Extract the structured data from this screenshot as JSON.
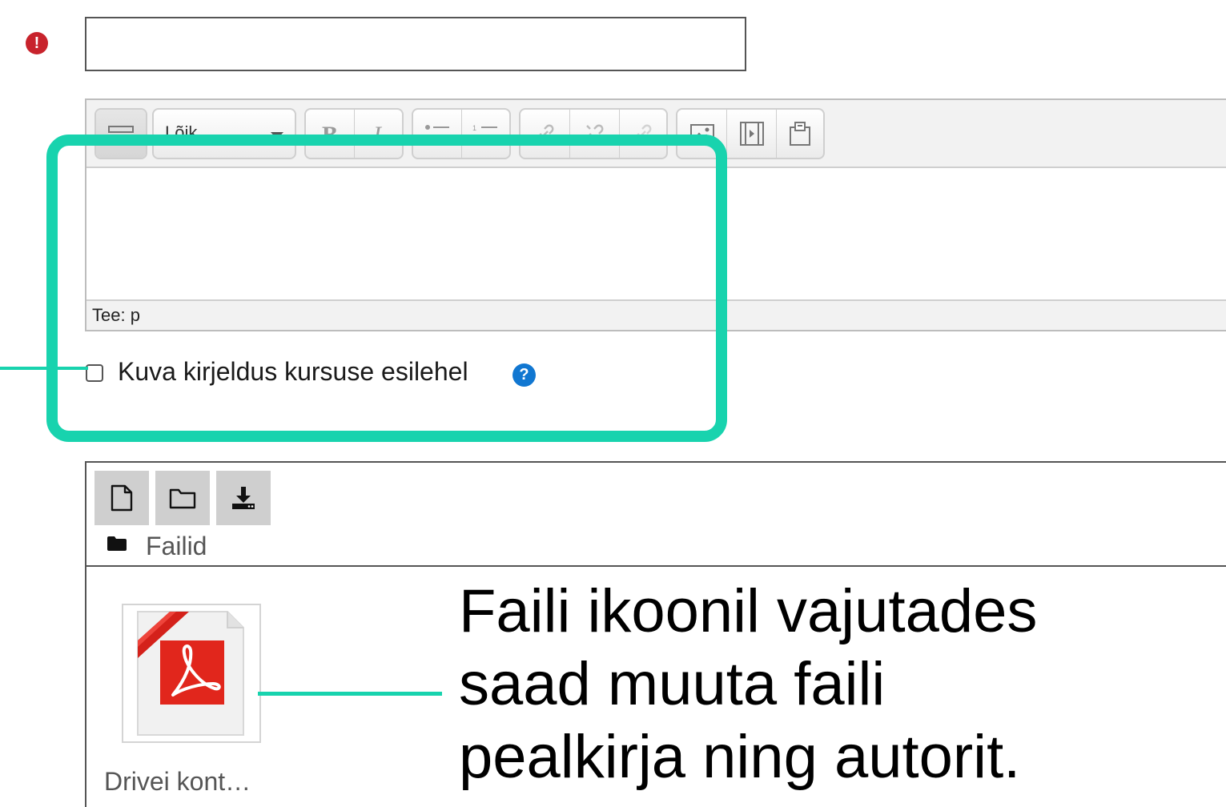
{
  "form": {
    "name_value": "",
    "show_description_label": "Kuva kirjeldus kursuse esilehel",
    "help_glyph": "?"
  },
  "editor": {
    "format_select_value": "Lõik",
    "path_label": "Tee: p",
    "content": "",
    "toolbar_icons": [
      "toolbar-toggle-icon",
      "bold-icon",
      "italic-icon",
      "unordered-list-icon",
      "ordered-list-icon",
      "link-icon",
      "unlink-icon",
      "manage-links-icon",
      "image-icon",
      "media-icon",
      "manage-files-icon"
    ]
  },
  "filemanager": {
    "toolbar_icons": [
      "add-file-icon",
      "create-folder-icon",
      "download-icon"
    ],
    "path_label": "Failid",
    "files": [
      {
        "name": "Drivei kont…",
        "icon": "pdf-file-icon"
      }
    ]
  },
  "annotation": {
    "lines": [
      "Faili ikoonil vajutades",
      "saad muuta faili",
      "pealkirja ning autorit."
    ],
    "color": "#18d3ae"
  },
  "colors": {
    "required": "#c8232c",
    "help": "#1177d1",
    "highlight": "#18d3ae",
    "pdf_red": "#e1261c"
  }
}
